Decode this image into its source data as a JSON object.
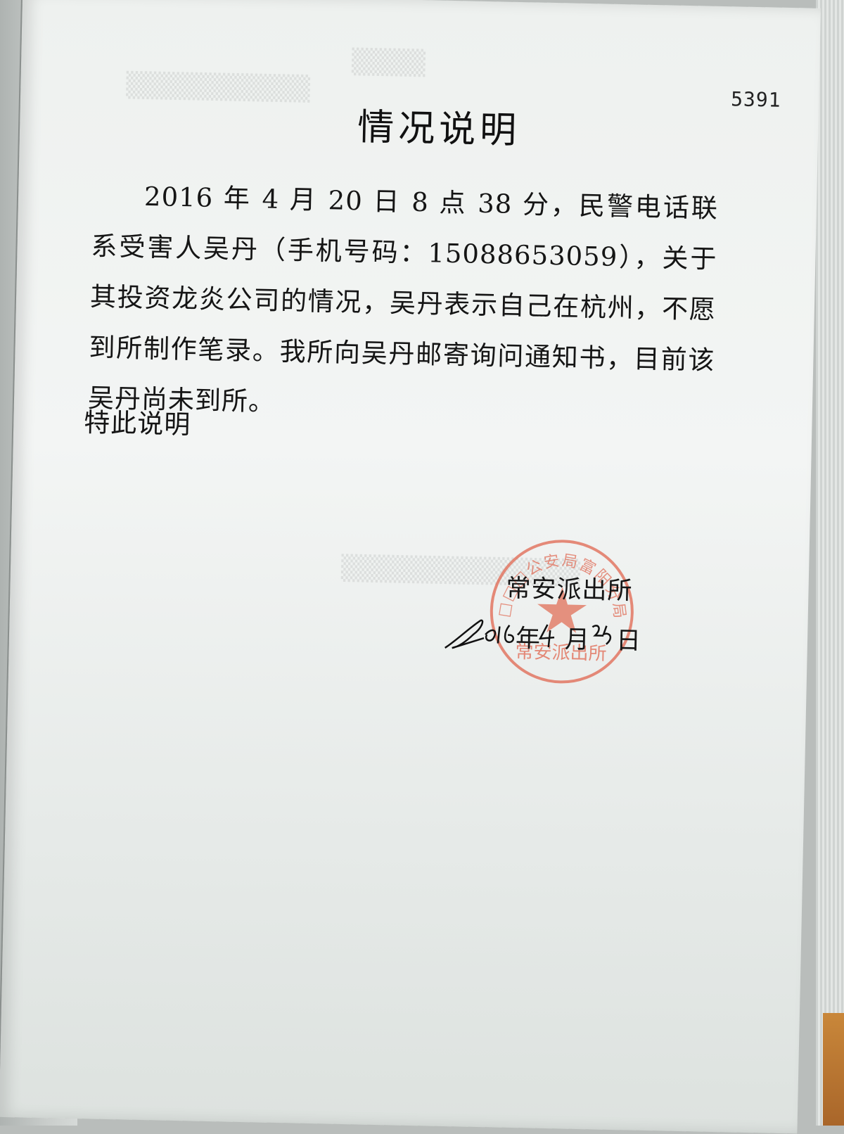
{
  "document": {
    "page_number": "5391",
    "title": "情况说明",
    "body": "2016 年 4 月 20 日 8 点 38 分，民警电话联系受害人吴丹（手机号码：15088653059），关于其投资龙炎公司的情况，吴丹表示自己在杭州，不愿到所制作笔录。我所向吴丹邮寄询问通知书，目前该吴丹尚未到所。",
    "closing": "特此说明",
    "signer": "常安派出所",
    "date_year_char": "年",
    "date_month_char": "月",
    "date_day_char": "日",
    "date_handwritten": "2016 年 4 月 25 日",
    "stamp": {
      "outer_text": "□□□公安局富阳分局",
      "inner_text": "常安派出所",
      "color": "#e0664f"
    }
  },
  "colors": {
    "paper": "#f3f5f4",
    "ink": "#151515",
    "stamp_red": "#e0664f",
    "background": "#b9bdbb"
  }
}
